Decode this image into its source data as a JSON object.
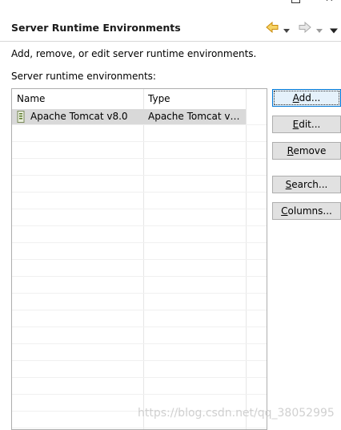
{
  "window": {
    "title": "Server Runtime Environments"
  },
  "header": {
    "title": "Server Runtime Environments",
    "back_icon": "back-arrow-icon",
    "forward_icon": "forward-arrow-icon",
    "accent": "#e0a21a"
  },
  "description": "Add, remove, or edit server runtime environments.",
  "list_label": "Server runtime environments:",
  "table": {
    "columns": [
      "Name",
      "Type"
    ],
    "rows": [
      {
        "name": "Apache Tomcat v8.0",
        "type": "Apache Tomcat v…",
        "icon": "server-icon",
        "selected": true
      }
    ]
  },
  "buttons": {
    "add": {
      "mnemonic": "A",
      "rest": "dd..."
    },
    "edit": {
      "mnemonic": "E",
      "rest": "dit..."
    },
    "remove": {
      "mnemonic": "R",
      "rest": "emove"
    },
    "search": {
      "mnemonic": "S",
      "rest": "earch..."
    },
    "columns": {
      "mnemonic": "C",
      "rest": "olumns..."
    }
  },
  "watermark": "https://blog.csdn.net/qq_38052995"
}
